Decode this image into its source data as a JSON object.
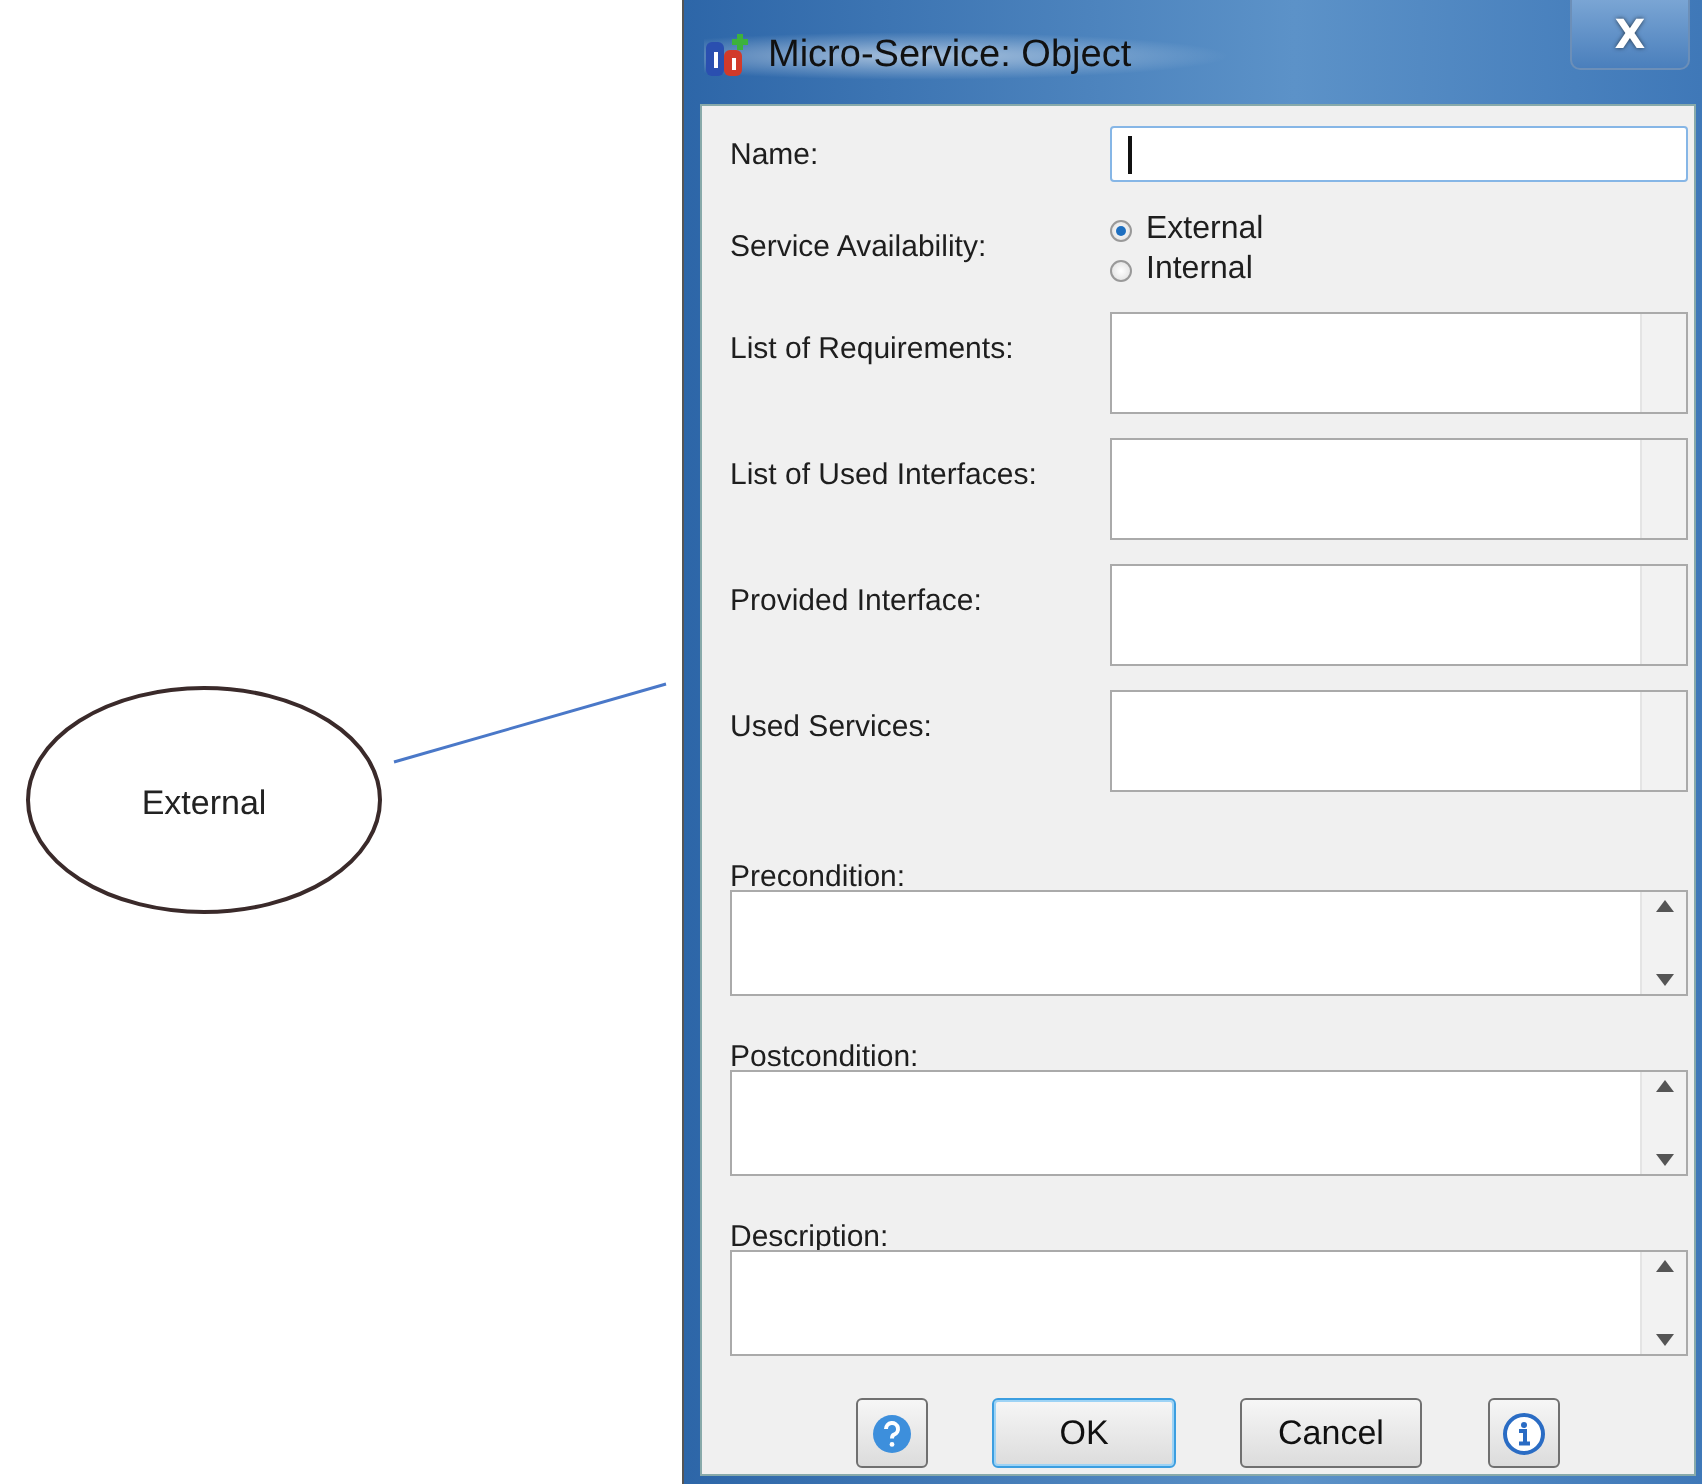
{
  "annotation": {
    "label": "External"
  },
  "window": {
    "title": "Micro-Service: Object",
    "close": "X"
  },
  "form": {
    "rows": [
      {
        "kind": "text",
        "label": "Name:",
        "focused": true
      },
      {
        "kind": "radio",
        "label": "Service Availability:",
        "options": [
          {
            "label": "External",
            "selected": true
          },
          {
            "label": "Internal",
            "selected": false
          }
        ]
      },
      {
        "kind": "list",
        "label": "List of Requirements:"
      },
      {
        "kind": "list",
        "label": "List of Used Interfaces:"
      },
      {
        "kind": "list",
        "label": "Provided Interface:"
      },
      {
        "kind": "list",
        "label": "Used Services:"
      },
      {
        "kind": "area",
        "label": "Precondition:"
      },
      {
        "kind": "area",
        "label": "Postcondition:"
      },
      {
        "kind": "area",
        "label": "Description:"
      }
    ]
  },
  "buttons": [
    {
      "kind": "help"
    },
    {
      "kind": "text",
      "label": "OK",
      "default": true
    },
    {
      "kind": "text",
      "label": "Cancel",
      "default": false
    },
    {
      "kind": "info"
    }
  ]
}
